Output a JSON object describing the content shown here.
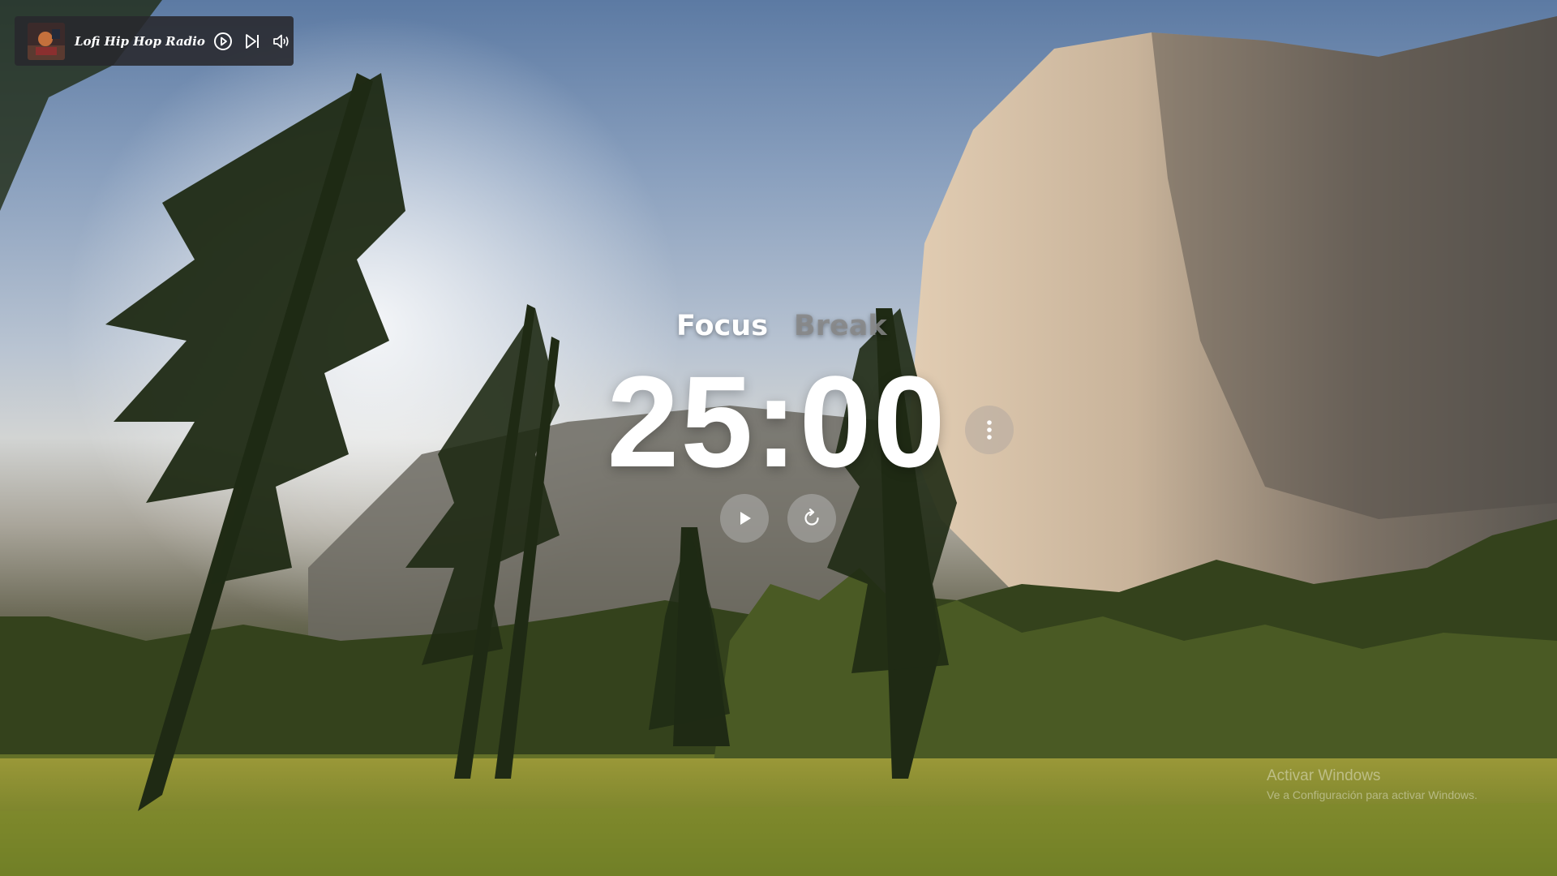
{
  "music_player": {
    "station_name": "Lofi Hip Hop Radio",
    "cover_icon": "album-cover",
    "controls": [
      {
        "name": "play",
        "icon": "play-circle-icon"
      },
      {
        "name": "skip",
        "icon": "skip-next-icon"
      },
      {
        "name": "volume",
        "icon": "speaker-volume-icon"
      }
    ]
  },
  "timer": {
    "modes": [
      {
        "label": "Focus",
        "active": true
      },
      {
        "label": "Break",
        "active": false
      }
    ],
    "time": "25:00",
    "more_icon": "vertical-dots-icon",
    "play_icon": "play-icon",
    "reset_icon": "refresh-icon"
  },
  "watermark": {
    "title": "Activar Windows",
    "subtitle": "Ve a Configuración para activar Windows."
  },
  "colors": {
    "widget_bg": "#28282c",
    "text_primary": "#ffffff",
    "mode_inactive": "#878787"
  }
}
